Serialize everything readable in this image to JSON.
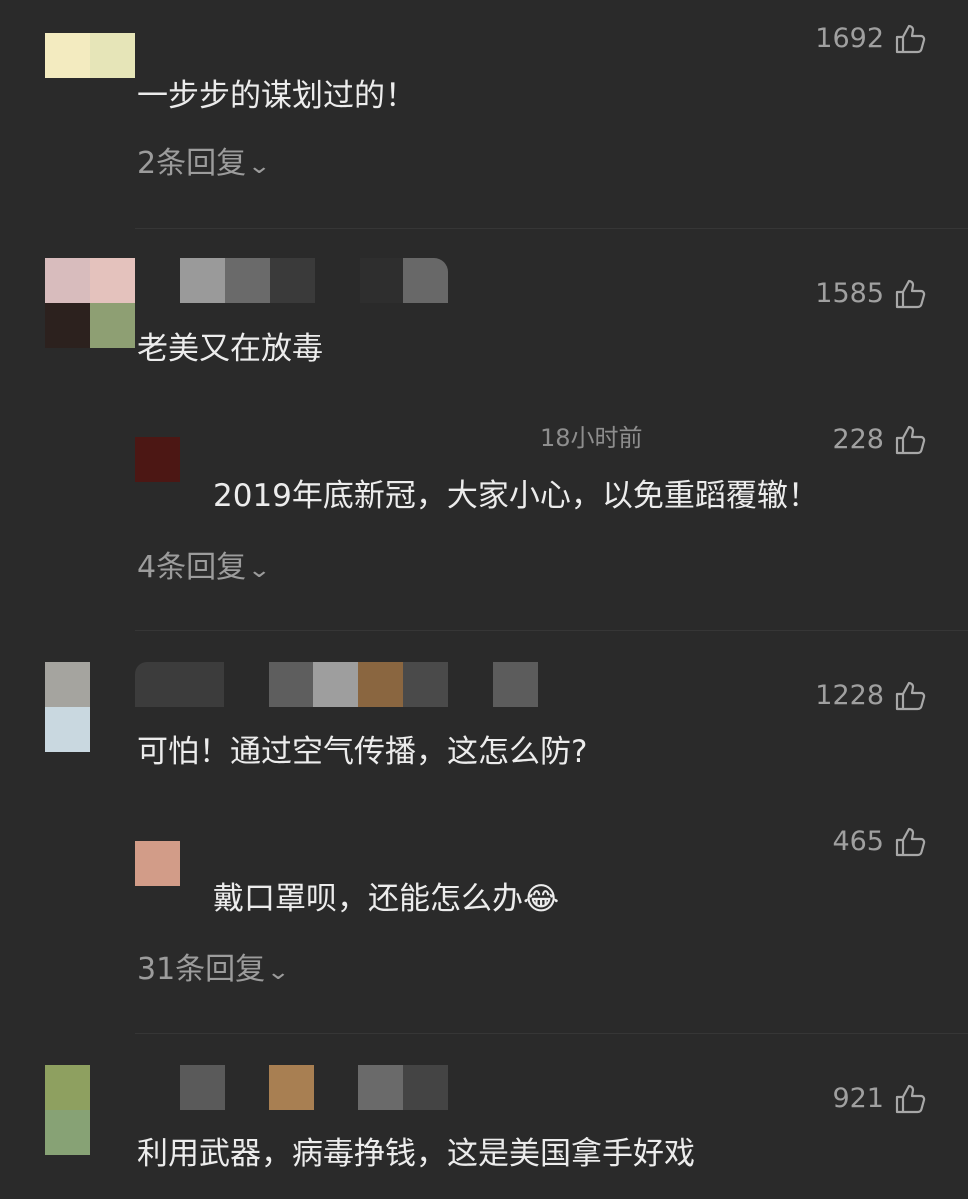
{
  "comments": [
    {
      "avatar_colors": [
        "#f3ebc0",
        "#e6e5b8"
      ],
      "name_colors": [],
      "likes": "1692",
      "text": "一步步的谋划过的！",
      "replies_label": "2条回复"
    },
    {
      "avatar_colors": [
        "#d8bcbd",
        "#e4c2bd",
        "#2c211e",
        "#8e9f73"
      ],
      "name_colors": [
        "#9a9a9a",
        "#6a6a6a",
        "#3a3a3a",
        "#2e2e2e",
        "#686868"
      ],
      "likes": "1585",
      "text": "老美又在放毒",
      "reply": {
        "avatar_color": "#4c1714",
        "time": "18小时前",
        "likes": "228",
        "text": "2019年底新冠，大家小心，以免重蹈覆辙！"
      },
      "replies_label": "4条回复"
    },
    {
      "avatar_colors": [
        "#a5a49f",
        "#c9d8e0"
      ],
      "name_colors": [
        "#3c3c3c",
        "#5e5e5e",
        "#9e9e9e",
        "#8a6640",
        "#4a4a4a",
        "#5c5c5c"
      ],
      "likes": "1228",
      "text": "可怕！通过空气传播，这怎么防?",
      "reply": {
        "avatar_color": "#d29c88",
        "likes": "465",
        "text": "戴口罩呗，还能怎么办",
        "emoji": "😂"
      },
      "replies_label": "31条回复"
    },
    {
      "avatar_colors": [
        "#8ea060",
        "#87a275"
      ],
      "name_colors": [
        "#5a5a5a",
        "#a87f52",
        "#6a6a6a",
        "#444444"
      ],
      "likes": "921",
      "text": "利用武器，病毒挣钱，这是美国拿手好戏"
    }
  ],
  "icons": {
    "like": "thumbs-up-icon",
    "expand": "chevron-down-icon"
  },
  "colors": {
    "background": "#2a2a2a",
    "text": "#ececec",
    "muted": "#9c9c9c"
  }
}
